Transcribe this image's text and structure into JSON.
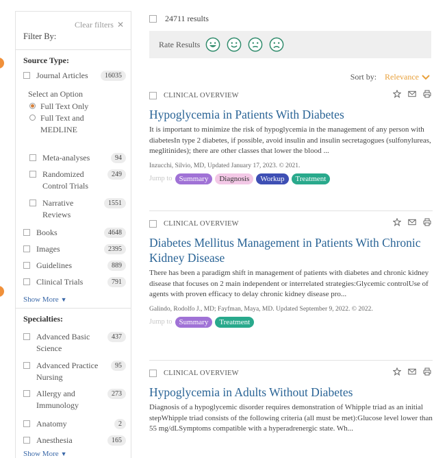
{
  "sidebar": {
    "clear_filters": "Clear filters",
    "filter_by": "Filter By:",
    "source_type": {
      "title": "Source Type:",
      "journal": {
        "label": "Journal Articles",
        "count": "16035"
      },
      "select_option": "Select an Option",
      "options": [
        {
          "label": "Full Text Only",
          "selected": true
        },
        {
          "label": "Full Text and MEDLINE",
          "selected": false
        }
      ],
      "sub_items": [
        {
          "label": "Meta-analyses",
          "count": "94"
        },
        {
          "label": "Randomized Control Trials",
          "count": "249"
        },
        {
          "label": "Narrative Reviews",
          "count": "1551"
        }
      ],
      "items": [
        {
          "label": "Books",
          "count": "4648"
        },
        {
          "label": "Images",
          "count": "2395"
        },
        {
          "label": "Guidelines",
          "count": "889"
        },
        {
          "label": "Clinical Trials",
          "count": "791"
        }
      ],
      "show_more": "Show More"
    },
    "specialties": {
      "title": "Specialties:",
      "items": [
        {
          "label": "Advanced Basic Science",
          "count": "437"
        },
        {
          "label": "Advanced Practice Nursing",
          "count": "95"
        },
        {
          "label": "Allergy and Immunology",
          "count": "273"
        },
        {
          "label": "Anatomy",
          "count": "2"
        },
        {
          "label": "Anesthesia",
          "count": "165"
        }
      ],
      "show_more": "Show More"
    }
  },
  "main": {
    "results_count": "24711 results",
    "rate_label": "Rate Results",
    "rate_faces": [
      "very-happy-face-icon",
      "happy-face-icon",
      "neutral-face-icon",
      "sad-face-icon"
    ],
    "sort_label": "Sort by:",
    "sort_value": "Relevance",
    "jump_to": "Jump to",
    "cards": [
      {
        "category": "CLINICAL OVERVIEW",
        "title": "Hypoglycemia in Patients With Diabetes",
        "description": "It is important to minimize the risk of hypoglycemia in the management of any person with diabetesIn type 2 diabetes, if possible, avoid insulin and insulin secretagogues (sulfonylureas, meglitinides); there are other classes that lower the blood ...",
        "meta": "Inzucchi, Silvio, MD, Updated January 17, 2023. © 2021.",
        "tags": [
          "Summary",
          "Diagnosis",
          "Workup",
          "Treatment"
        ]
      },
      {
        "category": "CLINICAL OVERVIEW",
        "title": "Diabetes Mellitus Management in Patients With Chronic Kidney Disease",
        "description": "There has been a paradigm shift in management of patients with diabetes and chronic kidney disease that focuses on 2 main independent or interrelated strategies:Glycemic controlUse of agents with proven efficacy to delay chronic kidney disease pro...",
        "meta": "Galindo, Rodolfo J., MD; Fayfman, Maya, MD. Updated September 9, 2022. © 2022.",
        "tags": [
          "Summary",
          "Treatment"
        ]
      },
      {
        "category": "CLINICAL OVERVIEW",
        "title": "Hypoglycemia in Adults Without Diabetes",
        "description": "Diagnosis of a hypoglycemic disorder requires demonstration of Whipple triad as an initial stepWhipple triad consists of the following criteria (all must be met):Glucose level lower than 55 mg/dLSymptoms compatible with a hyperadrenergic state. Wh...",
        "meta": "",
        "tags": []
      }
    ]
  },
  "colors": {
    "accent": "#e8a03a",
    "link": "#2a6496",
    "summary": "#a072d6",
    "diagnosis": "#f3c8e6",
    "workup": "#3e4fb4",
    "treatment": "#29a98c"
  }
}
